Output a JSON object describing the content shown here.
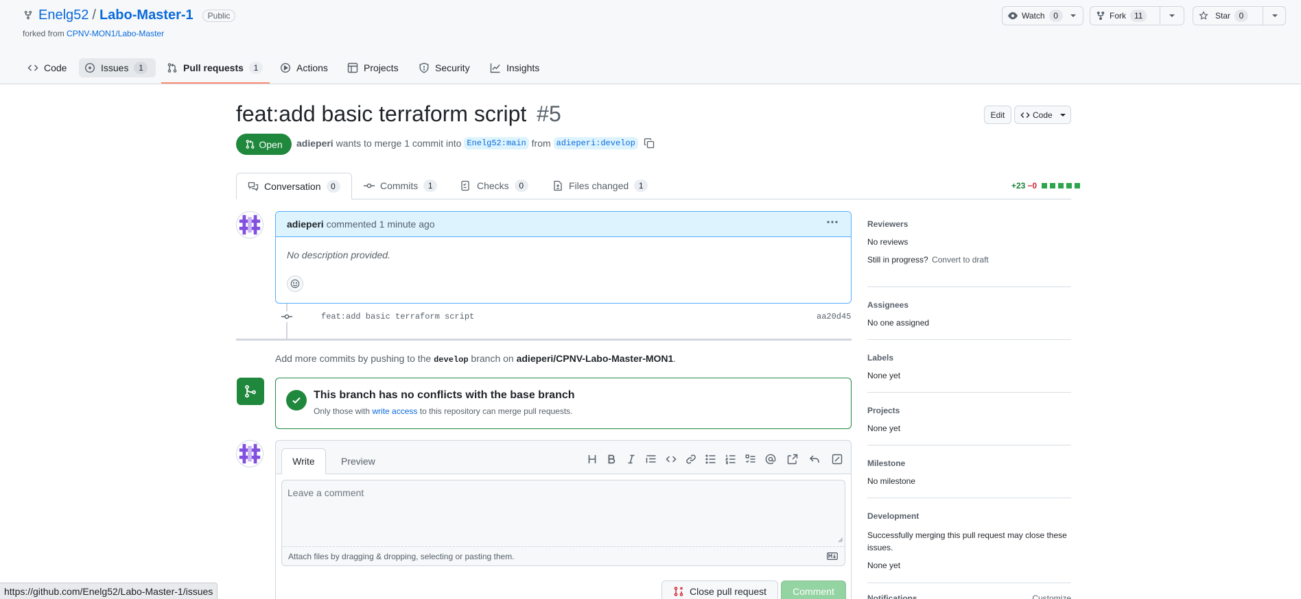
{
  "repo": {
    "owner": "Enelg52",
    "separator": "/",
    "name": "Labo-Master-1",
    "visibility": "Public",
    "forked_prefix": "forked from ",
    "forked_from": "CPNV-MON1/Labo-Master"
  },
  "actions": {
    "watch_label": "Watch",
    "watch_count": "0",
    "fork_label": "Fork",
    "fork_count": "11",
    "star_label": "Star",
    "star_count": "0"
  },
  "nav": {
    "code": "Code",
    "issues": "Issues",
    "issues_count": "1",
    "pulls": "Pull requests",
    "pulls_count": "1",
    "actions": "Actions",
    "projects": "Projects",
    "security": "Security",
    "insights": "Insights"
  },
  "pr": {
    "title": "feat:add basic terraform script",
    "number": "#5",
    "state": "Open",
    "author": "adieperi",
    "merge_text": " wants to merge 1 commit into ",
    "base": "Enelg52:main",
    "from_text": " from ",
    "head": "adieperi:develop",
    "edit_label": "Edit",
    "code_label": "Code"
  },
  "tabs": {
    "conversation": "Conversation",
    "conversation_count": "0",
    "commits": "Commits",
    "commits_count": "1",
    "checks": "Checks",
    "checks_count": "0",
    "files": "Files changed",
    "files_count": "1",
    "additions": "+23",
    "deletions": "−0"
  },
  "comment": {
    "author": "adieperi",
    "action": " commented ",
    "time": "1 minute ago",
    "body": "No description provided."
  },
  "commit": {
    "message": "feat:add basic terraform script",
    "sha": "aa20d45"
  },
  "push_hint": {
    "prefix": "Add more commits by pushing to the ",
    "branch": "develop",
    "middle": " branch on ",
    "repo": "adieperi/CPNV-Labo-Master-MON1",
    "suffix": "."
  },
  "merge": {
    "title": "This branch has no conflicts with the base branch",
    "desc_prefix": "Only those with ",
    "desc_link": "write access",
    "desc_suffix": " to this repository can merge pull requests."
  },
  "editor": {
    "tab_write": "Write",
    "tab_preview": "Preview",
    "placeholder": "Leave a comment",
    "attach_hint": "Attach files by dragging & dropping, selecting or pasting them.",
    "close_pr": "Close pull request",
    "comment_btn": "Comment"
  },
  "sidebar": {
    "reviewers_h": "Reviewers",
    "reviewers_v": "No reviews",
    "progress_q": "Still in progress?",
    "convert_draft": "Convert to draft",
    "assignees_h": "Assignees",
    "assignees_v": "No one assigned",
    "labels_h": "Labels",
    "labels_v": "None yet",
    "projects_h": "Projects",
    "projects_v": "None yet",
    "milestone_h": "Milestone",
    "milestone_v": "No milestone",
    "development_h": "Development",
    "development_desc": "Successfully merging this pull request may close these issues.",
    "development_v": "None yet",
    "notifications_h": "Notifications",
    "customize": "Customize"
  },
  "status_bar": {
    "url": "https://github.com/Enelg52/Labo-Master-1/issues"
  },
  "colors": {
    "link": "#0969da",
    "open_green": "#1f883d",
    "accent_orange": "#fd8c73",
    "comment_header_bg": "#ddf4ff",
    "avatar_purple": "#8250df"
  }
}
